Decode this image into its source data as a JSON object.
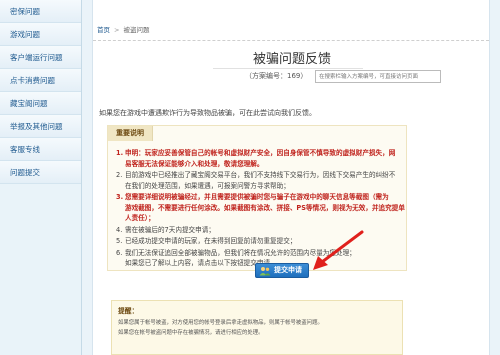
{
  "sidebar": {
    "items": [
      {
        "label": "密保问题"
      },
      {
        "label": "游戏问题"
      },
      {
        "label": "客户端运行问题"
      },
      {
        "label": "点卡消费问题"
      },
      {
        "label": "藏宝阁问题"
      },
      {
        "label": "举报及其他问题"
      },
      {
        "label": "客服专线"
      },
      {
        "label": "问题提交"
      }
    ]
  },
  "breadcrumb": {
    "home": "首页",
    "current": "被盗问题"
  },
  "page": {
    "title": "被骗问题反馈",
    "case_label": "（方案编号：",
    "case_number": "169",
    "case_close": "）",
    "search_placeholder": "在搜索栏输入方案编号，可直接访问页面"
  },
  "intro_text": "如果您在游戏中遭遇欺诈行为导致物品被骗，可在此尝试向我们反馈。",
  "notice": {
    "tab_label": "重要说明",
    "items": [
      {
        "num": "1.",
        "text": "申明：玩家应妥善保管自己的帐号和虚拟财产安全，因自身保管不慎导致的虚拟财产损失，网",
        "cont": "易客服无法保证能够介入和处理，敬请您理解。",
        "red": false,
        "bold": true
      },
      {
        "num": "2.",
        "text": "目前游戏中已经推出了藏宝阁交易平台，我们不支持线下交易行为，因线下交易产生的纠纷不",
        "cont": "在我们的处理范围，如果遭遇，可报案问警方寻求帮助；",
        "red": false,
        "bold": false
      },
      {
        "num": "3.",
        "text": "您需要详细说明被骗经过，并且需要提供被骗时您与骗子在游戏中的聊天信息等截图（需为",
        "cont": "游戏截图，不需要进行任何涂改。如果截图有涂改、拼接、PS等情况，则视为无效，并追究提单人责任）；",
        "red": true,
        "bold": true
      },
      {
        "num": "4.",
        "text": "需在被骗后的7天内提交申请；",
        "cont": "",
        "red": false,
        "bold": false
      },
      {
        "num": "5.",
        "text": "已经成功提交申请的玩家，在未得到回复前请勿重复提交；",
        "cont": "",
        "red": false,
        "bold": false
      },
      {
        "num": "6.",
        "text": "我们无法保证追回全部被骗物品，但我们将在情况允许的范围内尽量为您处理；",
        "cont": "",
        "red": false,
        "bold": false
      }
    ],
    "confirm_text": "如果您已了解以上内容，请点击以下按钮提交申请。"
  },
  "apply_button": {
    "label": "提交申请"
  },
  "tip": {
    "title": "提醒：",
    "line1": "如果您属于帐号被盗，对方使用您的帐号登录后拿走虚拟物品，则属于帐号被盗问题。",
    "line2": "如果您在帐号被盗问题中存在被骗情况，请进行相应的处理。"
  },
  "colors": {
    "accent_red": "#c0241e",
    "link_blue": "#1f5a8f",
    "button_blue": "#1f6fbd"
  }
}
